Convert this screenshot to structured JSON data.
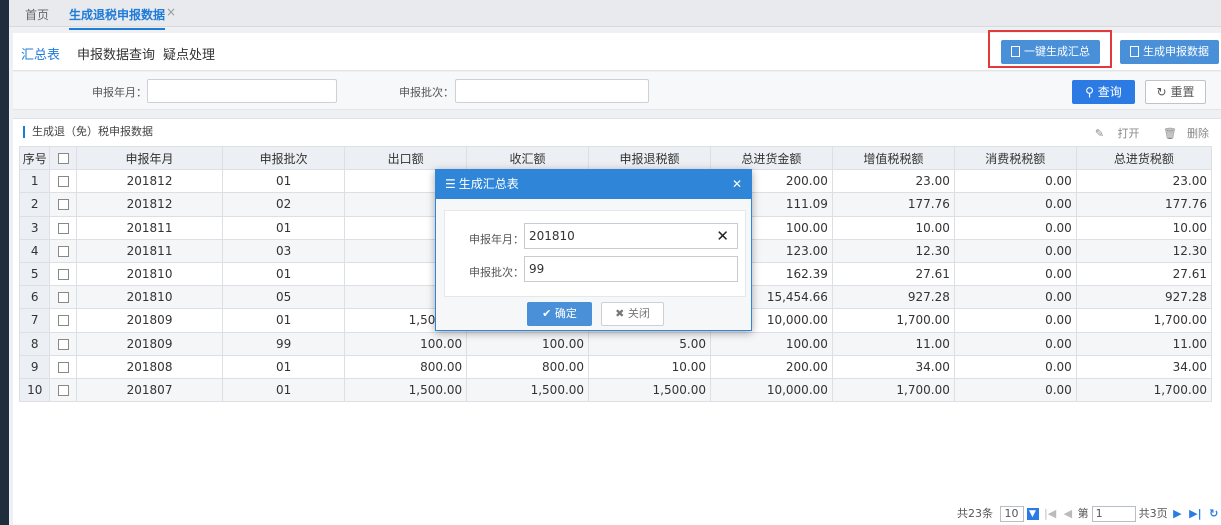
{
  "tabs": {
    "home": "首页",
    "active": "生成退税申报数据",
    "close": "×"
  },
  "subtabs": [
    "汇总表",
    "申报数据查询",
    "疑点处理"
  ],
  "toolbar": {
    "oneclick_label": "一键生成汇总",
    "generate_label": "生成申报数据"
  },
  "search": {
    "year_month_label": "申报年月：",
    "batch_label": "申报批次：",
    "query_label": "查询",
    "reset_label": "重置"
  },
  "panel": {
    "title": "生成退（免）税申报数据",
    "open_label": "打开",
    "delete_label": "删除"
  },
  "table": {
    "headers": [
      "序号",
      "",
      "申报年月",
      "申报批次",
      "出口额",
      "收汇额",
      "申报退税额",
      "总进货金额",
      "增值税税额",
      "消费税税额",
      "总进货税额"
    ],
    "rows": [
      [
        "1",
        "201812",
        "01",
        "",
        "",
        "",
        "200.00",
        "23.00",
        "0.00",
        "23.00"
      ],
      [
        "2",
        "201812",
        "02",
        "",
        "",
        "",
        "111.09",
        "177.76",
        "0.00",
        "177.76"
      ],
      [
        "3",
        "201811",
        "01",
        "",
        "",
        "",
        "100.00",
        "10.00",
        "0.00",
        "10.00"
      ],
      [
        "4",
        "201811",
        "03",
        "",
        "",
        "",
        "123.00",
        "12.30",
        "0.00",
        "12.30"
      ],
      [
        "5",
        "201810",
        "01",
        "",
        "",
        "",
        "162.39",
        "27.61",
        "0.00",
        "27.61"
      ],
      [
        "6",
        "201810",
        "05",
        "",
        "",
        "",
        "15,454.66",
        "927.28",
        "0.00",
        "927.28"
      ],
      [
        "7",
        "201809",
        "01",
        "1,500.00",
        "1,500.00",
        "1,500.00",
        "10,000.00",
        "1,700.00",
        "0.00",
        "1,700.00"
      ],
      [
        "8",
        "201809",
        "99",
        "100.00",
        "100.00",
        "5.00",
        "100.00",
        "11.00",
        "0.00",
        "11.00"
      ],
      [
        "9",
        "201808",
        "01",
        "800.00",
        "800.00",
        "10.00",
        "200.00",
        "34.00",
        "0.00",
        "34.00"
      ],
      [
        "10",
        "201807",
        "01",
        "1,500.00",
        "1,500.00",
        "1,500.00",
        "10,000.00",
        "1,700.00",
        "0.00",
        "1,700.00"
      ]
    ]
  },
  "pager": {
    "total": "共23条",
    "page_size": "10",
    "page_prefix": "第",
    "page_value": "1",
    "page_total": "共3页"
  },
  "dialog": {
    "title": "生成汇总表",
    "year_month_label": "申报年月：",
    "year_month_value": "201810",
    "batch_label": "申报批次：",
    "batch_value": "99",
    "ok_label": "确定",
    "cancel_label": "关闭"
  },
  "colors": {
    "primary": "#2c7be5",
    "dialog_header": "#2f86d9",
    "highlight_border": "#e03a3a"
  }
}
